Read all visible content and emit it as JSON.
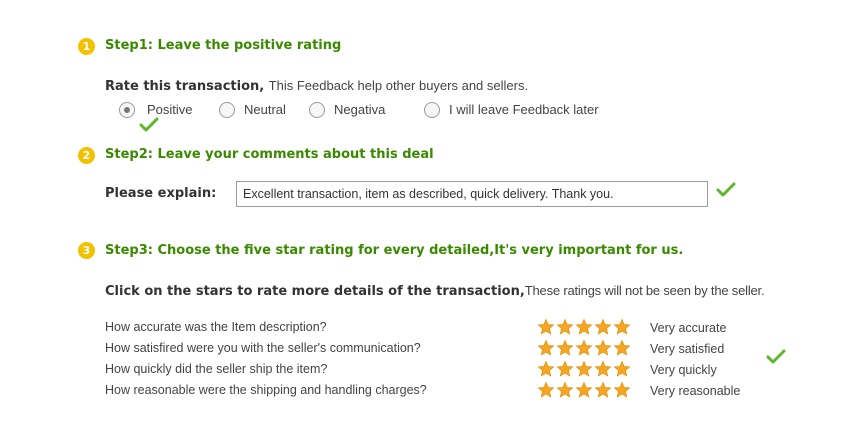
{
  "step1": {
    "badge": "1",
    "title": "Step1: Leave the positive rating",
    "rate_label": "Rate this transaction,",
    "rate_desc": "This Feedback help other buyers and sellers.",
    "options": [
      "Positive",
      "Neutral",
      "Negativa",
      "I will leave Feedback later"
    ],
    "selected": "Positive"
  },
  "step2": {
    "badge": "2",
    "title": "Step2: Leave your comments about this deal",
    "explain_label": "Please explain:",
    "comment_value": "Excellent transaction, item as described, quick delivery. Thank you."
  },
  "step3": {
    "badge": "3",
    "title": "Step3: Choose the five star rating for every detailed,It's very important for us.",
    "click_label": "Click on the stars to rate more details of the transaction,",
    "click_desc": "These ratings will not be seen by the seller.",
    "ratings": [
      {
        "question": "How accurate was the Item description?",
        "stars": 5,
        "label": "Very accurate"
      },
      {
        "question": "How satisfired were you with the seller's communication?",
        "stars": 5,
        "label": "Very satisfied"
      },
      {
        "question": "How quickly did the seller ship the item?",
        "stars": 5,
        "label": "Very quickly"
      },
      {
        "question": "How reasonable were the shipping and handling charges?",
        "stars": 5,
        "label": "Very reasonable"
      }
    ]
  },
  "colors": {
    "step_title": "#3a8a00",
    "badge": "#f2c200",
    "star": "#f5a623",
    "check": "#5cb82a"
  },
  "icons": {
    "check": "check-icon",
    "star": "star-icon"
  }
}
